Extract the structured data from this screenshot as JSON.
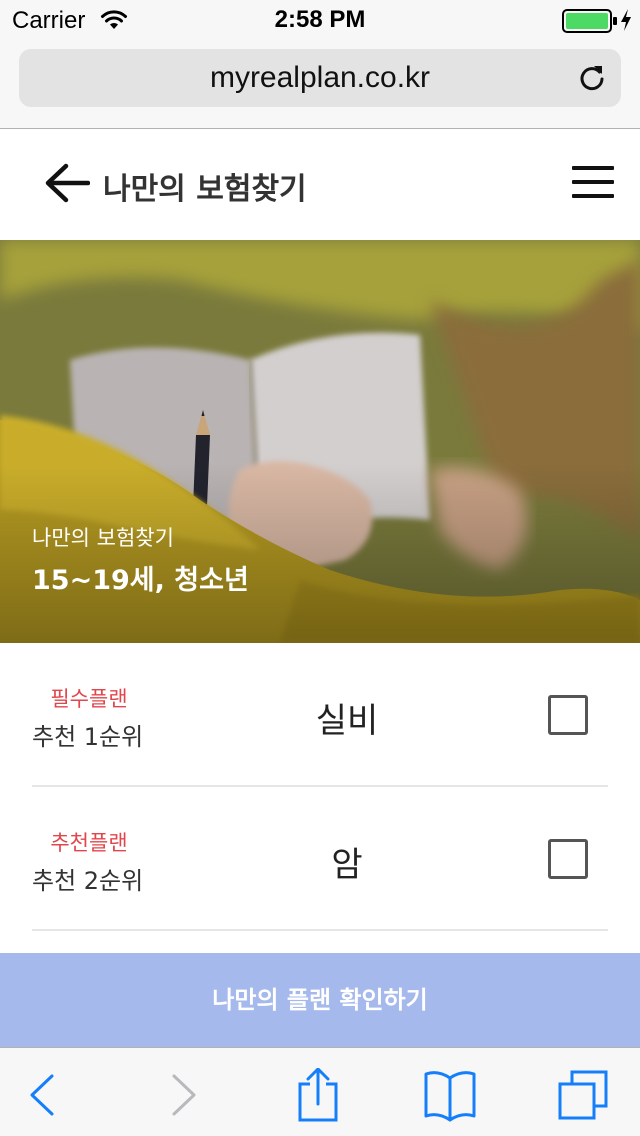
{
  "status_bar": {
    "carrier": "Carrier",
    "time": "2:58 PM",
    "battery_color": "#4cd964"
  },
  "browser": {
    "url": "myrealplan.co.kr"
  },
  "header": {
    "title": "나만의 보험찾기"
  },
  "hero": {
    "subtitle": "나만의 보험찾기",
    "title": "15~19세, 청소년"
  },
  "plans": [
    {
      "type": "필수플랜",
      "rank": "추천 1순위",
      "name": "실비",
      "checked": false
    },
    {
      "type": "추천플랜",
      "rank": "추천 2순위",
      "name": "암",
      "checked": false
    }
  ],
  "confirm_button": {
    "label": "나만의 플랜 확인하기",
    "color": "#a6b9ed"
  },
  "colors": {
    "plan_type": "#e0474c",
    "safari_tint": "#147efb"
  },
  "toolbar": {
    "icons": [
      "back-icon",
      "forward-icon",
      "share-icon",
      "bookmarks-icon",
      "tabs-icon"
    ]
  }
}
